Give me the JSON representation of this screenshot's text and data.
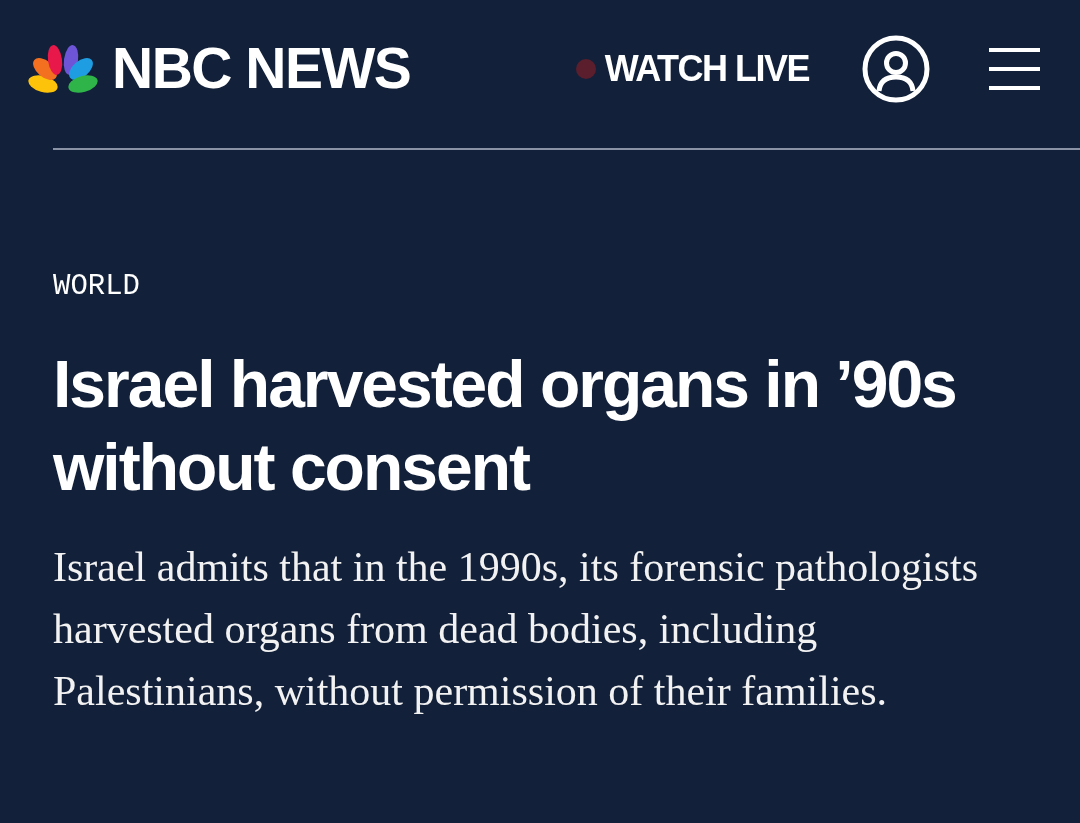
{
  "header": {
    "brand": "NBC NEWS",
    "watch_live": "WATCH LIVE"
  },
  "article": {
    "section": "WORLD",
    "headline": "Israel harvested organs in ’90s without consent",
    "summary": "Israel admits that in the 1990s, its forensic pathologists harvested organs from dead bodies, including Palestinians, without permission of their families."
  }
}
